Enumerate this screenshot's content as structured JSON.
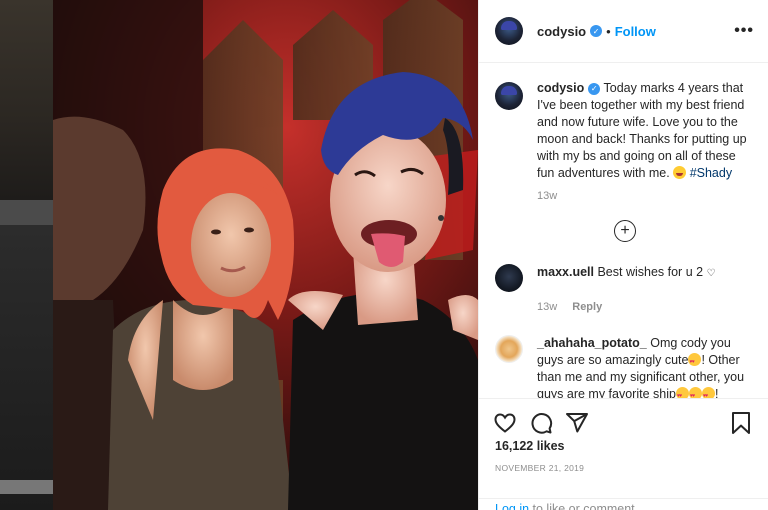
{
  "post": {
    "author": "codysio",
    "follow_label": "Follow",
    "dot": "•",
    "verified": true
  },
  "caption": {
    "username": "codysio",
    "text": "Today marks 4 years that I've been together with my best friend and now future wife. Love you to the moon and back! Thanks for putting up with my bs and going on all of these fun adventures with me.",
    "hashtag": "#Shady",
    "time": "13w"
  },
  "comments": [
    {
      "username": "maxx.uell",
      "text": "Best wishes for u 2",
      "time": "13w",
      "reply_label": "Reply"
    },
    {
      "username": "_ahahaha_potato_",
      "text_part1": "Omg cody you guys are so amazingly cute",
      "text_part2": "! Other than me and my significant other, you guys are my favorite ship",
      "text_part3": "!"
    }
  ],
  "stats": {
    "likes": "16,122 likes",
    "date": "NOVEMBER 21, 2019"
  },
  "login": {
    "link_text": "Log in",
    "rest_text": " to like or comment."
  },
  "icons": {
    "more": "more-options-icon",
    "load_more": "plus-circle-icon",
    "like": "heart-icon",
    "comment": "comment-bubble-icon",
    "share": "paper-plane-icon",
    "save": "bookmark-icon"
  },
  "colors": {
    "accent": "#0095f6",
    "verified": "#3897f0",
    "hashtag": "#00376b",
    "muted": "#8e8e8e"
  }
}
